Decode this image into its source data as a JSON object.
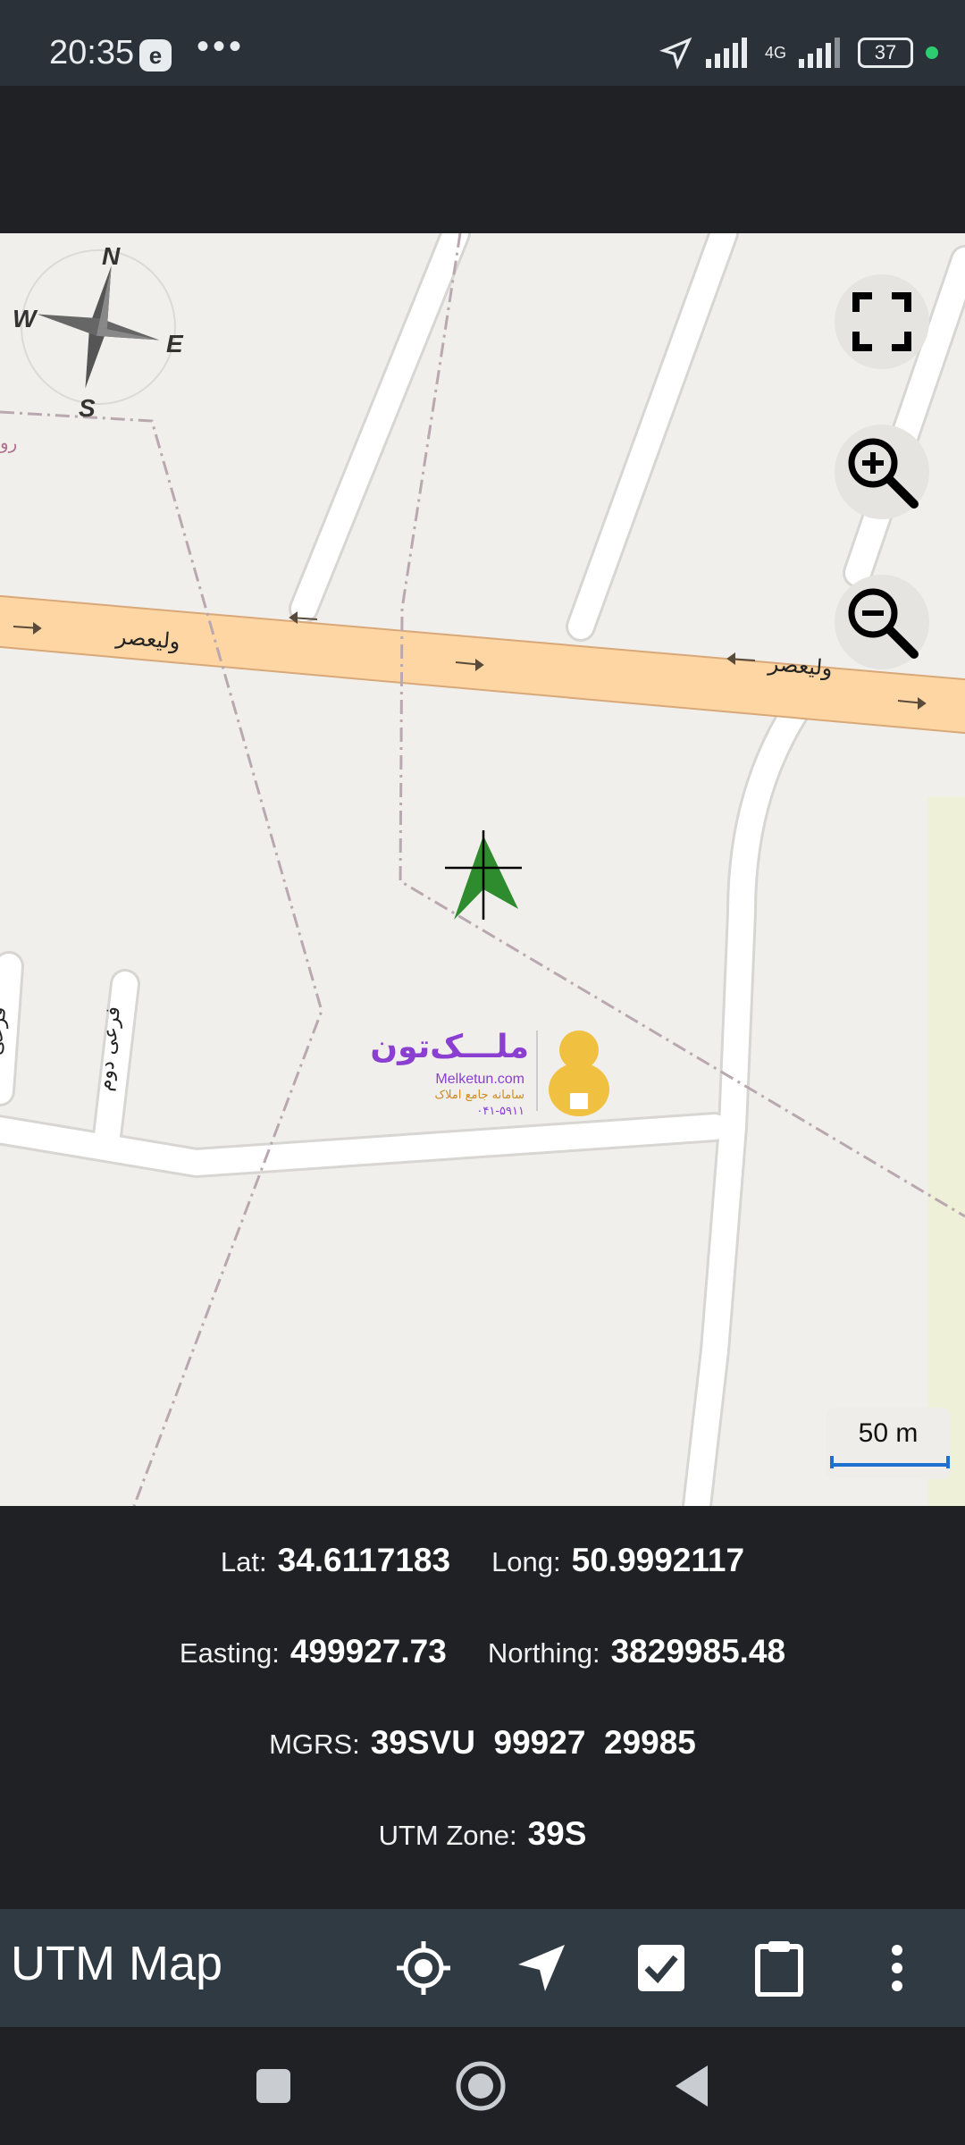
{
  "status_bar": {
    "time": "20:35",
    "app_badge": "e",
    "more": "•••",
    "network": "4G",
    "battery": "37"
  },
  "map": {
    "compass": {
      "n": "N",
      "s": "S",
      "e": "E",
      "w": "W"
    },
    "scale_label": "50 m",
    "road_main": "وليعصر",
    "road_side": "فرعی دوم",
    "road_edge": "فرعی",
    "road_partial": "رو",
    "logo": {
      "name": "ملـــک‌تون",
      "site": "Melketun.com",
      "tagline": "سامانه جامع املاک",
      "phone": "۰۴۱-۵۹۱۱"
    }
  },
  "coords": {
    "lat_label": "Lat:",
    "lat_value": "34.6117183",
    "long_label": "Long:",
    "long_value": "50.9992117",
    "easting_label": "Easting:",
    "easting_value": "499927.73",
    "northing_label": "Northing:",
    "northing_value": "3829985.48",
    "mgrs_label": "MGRS:",
    "mgrs_value": "39SVU  99927  29985",
    "zone_label": "UTM Zone:",
    "zone_value": "39S"
  },
  "app_bar": {
    "title": "UTM Map",
    "icons": [
      "my-location-icon",
      "navigation-icon",
      "checkbox-icon",
      "clipboard-icon",
      "overflow-menu-icon"
    ]
  },
  "nav_bar": {
    "icons": [
      "recents-icon",
      "home-icon",
      "back-icon"
    ]
  },
  "colors": {
    "road_major": "#fdd6a4",
    "road_minor": "#ffffff",
    "accent_green": "#2e8b2e",
    "logo_purple": "#8a3fd0",
    "scale_blue": "#1f6fd1"
  }
}
